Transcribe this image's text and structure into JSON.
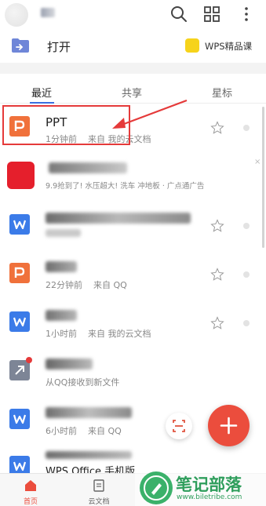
{
  "header": {
    "icons": [
      "search-icon",
      "grid-icon",
      "more-vertical-icon"
    ]
  },
  "open_row": {
    "label": "打开",
    "wps_label": "WPS精品课"
  },
  "tabs": [
    {
      "label": "最近",
      "active": true
    },
    {
      "label": "共享",
      "active": false
    },
    {
      "label": "星标",
      "active": false
    }
  ],
  "files": [
    {
      "type": "ppt",
      "title": "PPT",
      "time": "1分钟前",
      "source": "来自 我的云文档"
    },
    {
      "type": "ad",
      "title": "",
      "time": "9.9抢到了! 水压超大! 洗车 冲地板",
      "source": "· 广点通广告"
    },
    {
      "type": "doc",
      "title": "",
      "time": "",
      "source": ""
    },
    {
      "type": "ppt",
      "title": "",
      "time": "22分钟前",
      "source": "来自 QQ"
    },
    {
      "type": "doc",
      "title": "",
      "time": "1小时前",
      "source": "来自 我的云文档"
    },
    {
      "type": "pdf",
      "title": "",
      "time": "从QQ接收到新文件",
      "source": ""
    },
    {
      "type": "doc",
      "title": "",
      "time": "6小时前",
      "source": "来自 QQ"
    },
    {
      "type": "doc",
      "title": "WPS Office 手机版",
      "time": "",
      "source": ""
    }
  ],
  "ad_close": "×",
  "bottom_nav": [
    {
      "label": "首页",
      "icon": "home-icon",
      "active": true
    },
    {
      "label": "云文档",
      "icon": "cloud-doc-icon",
      "active": false
    }
  ],
  "watermark": {
    "text": "笔记部落",
    "url": "www.biletribe.com"
  },
  "colors": {
    "accent": "#3b6fe0",
    "ppt": "#f0713b",
    "doc": "#3b7be8",
    "fab": "#eb4d3d",
    "highlight": "#e53a3a"
  }
}
